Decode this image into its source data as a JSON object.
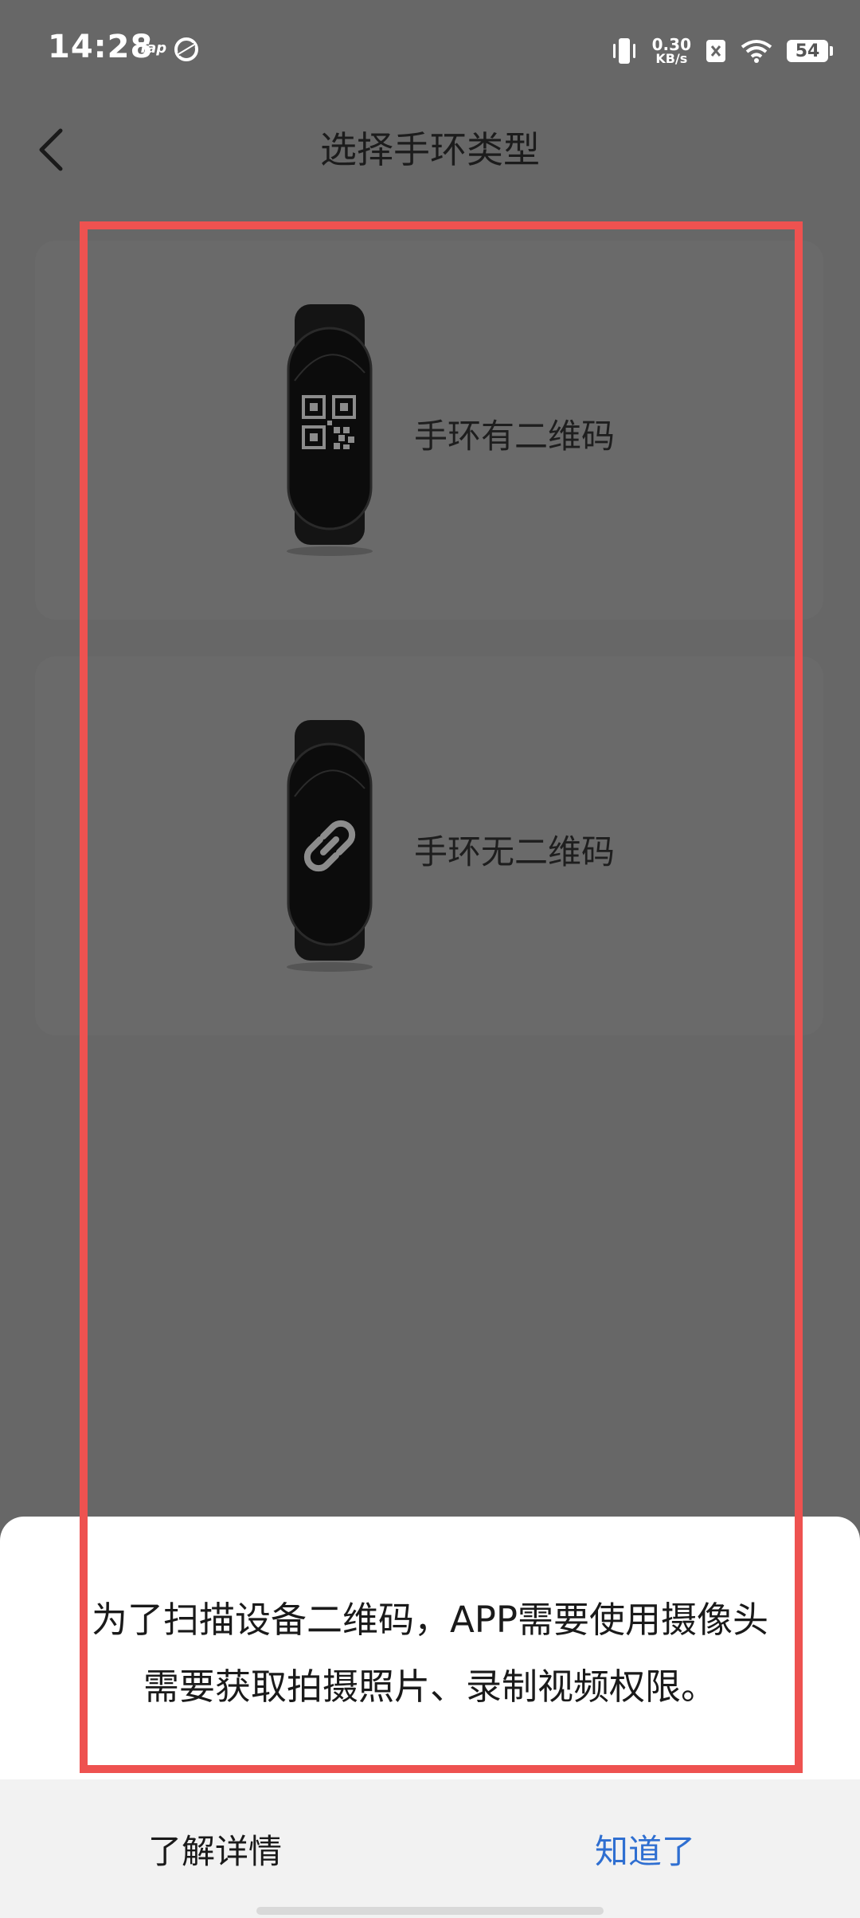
{
  "status_bar": {
    "time": "14:28",
    "tap_label": "Tap",
    "net_speed_value": "0.30",
    "net_speed_unit": "KB/s",
    "battery_level": "54"
  },
  "header": {
    "title": "选择手环类型"
  },
  "options": [
    {
      "label": "手环有二维码",
      "icon": "qr-code-icon"
    },
    {
      "label": "手环无二维码",
      "icon": "link-icon"
    }
  ],
  "sheet": {
    "message_line1": "为了扫描设备二维码，APP需要使用摄像头",
    "message_line2": "需要获取拍摄照片、录制视频权限。",
    "learn_more_label": "了解详情",
    "got_it_label": "知道了"
  },
  "colors": {
    "dim_background": "#676767",
    "highlight_border": "#ee5250",
    "accent_blue": "#2f6fd1"
  }
}
